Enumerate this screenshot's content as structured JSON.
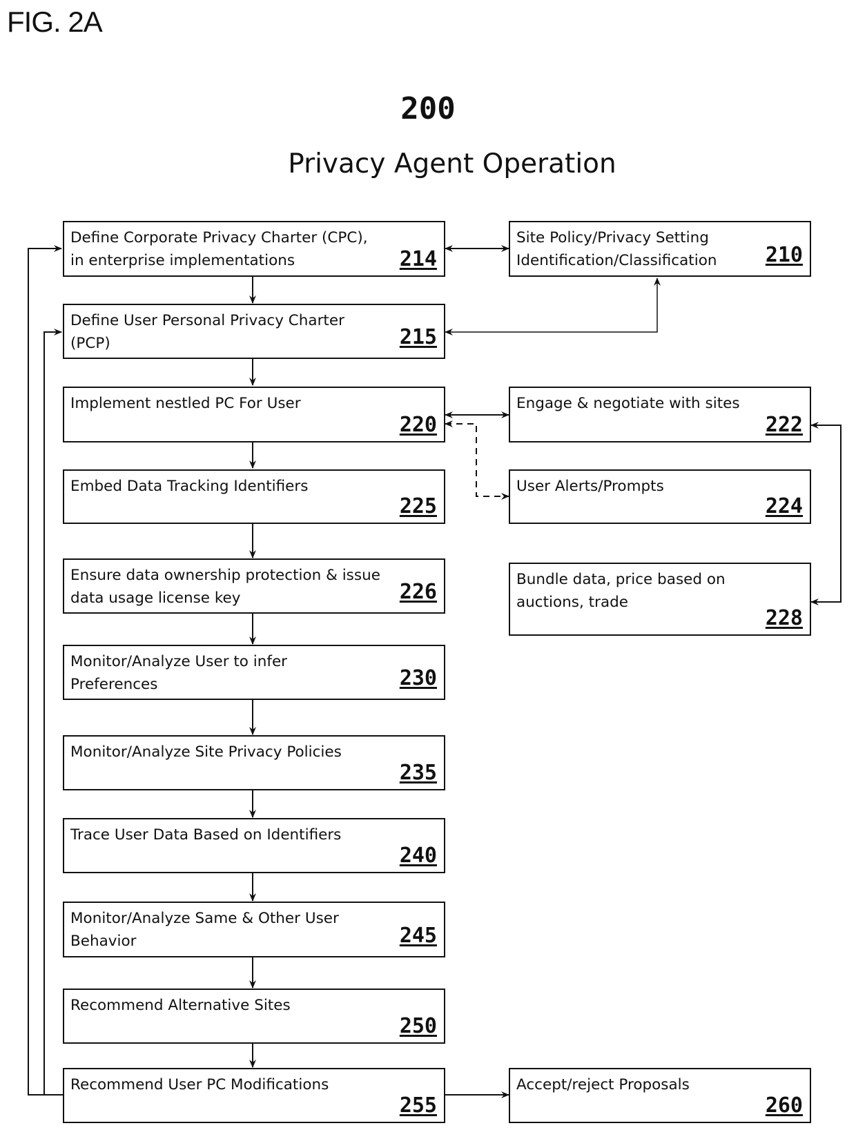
{
  "figure": {
    "label": "FIG. 2A",
    "number": "200",
    "title": "Privacy Agent Operation"
  },
  "boxes": {
    "b214": {
      "text": "Define Corporate Privacy Charter (CPC),\nin enterprise implementations",
      "ref": "214"
    },
    "b210": {
      "text": "Site Policy/Privacy Setting\nIdentification/Classification",
      "ref": "210"
    },
    "b215": {
      "text": "Define User Personal Privacy Charter\n(PCP)",
      "ref": "215"
    },
    "b220": {
      "text": "Implement nestled PC For User",
      "ref": "220"
    },
    "b222": {
      "text": "Engage & negotiate with sites",
      "ref": "222"
    },
    "b225": {
      "text": "Embed Data Tracking Identifiers",
      "ref": "225"
    },
    "b224": {
      "text": "User Alerts/Prompts",
      "ref": "224"
    },
    "b226": {
      "text": "Ensure data ownership protection & issue\ndata usage license key",
      "ref": "226"
    },
    "b228": {
      "text": "Bundle data, price based on\nauctions, trade",
      "ref": "228"
    },
    "b230": {
      "text": "Monitor/Analyze User to infer\nPreferences",
      "ref": "230"
    },
    "b235": {
      "text": "Monitor/Analyze Site Privacy Policies",
      "ref": "235"
    },
    "b240": {
      "text": "Trace User Data Based on Identifiers",
      "ref": "240"
    },
    "b245": {
      "text": "Monitor/Analyze Same & Other User\nBehavior",
      "ref": "245"
    },
    "b250": {
      "text": "Recommend Alternative Sites",
      "ref": "250"
    },
    "b255": {
      "text": "Recommend User PC Modifications",
      "ref": "255"
    },
    "b260": {
      "text": "Accept/reject Proposals",
      "ref": "260"
    }
  },
  "connections": [
    {
      "from": "214",
      "to": "210",
      "style": "solid",
      "direction": "both"
    },
    {
      "from": "214",
      "to": "215",
      "style": "solid",
      "direction": "forward"
    },
    {
      "from": "210",
      "to": "215",
      "style": "solid",
      "direction": "both"
    },
    {
      "from": "215",
      "to": "220",
      "style": "solid",
      "direction": "forward"
    },
    {
      "from": "220",
      "to": "222",
      "style": "solid",
      "direction": "both"
    },
    {
      "from": "220",
      "to": "224",
      "style": "dashed",
      "direction": "both"
    },
    {
      "from": "228",
      "to": "222",
      "style": "solid",
      "direction": "both"
    },
    {
      "from": "220",
      "to": "225",
      "style": "solid",
      "direction": "forward"
    },
    {
      "from": "225",
      "to": "226",
      "style": "solid",
      "direction": "forward"
    },
    {
      "from": "226",
      "to": "230",
      "style": "solid",
      "direction": "forward"
    },
    {
      "from": "230",
      "to": "235",
      "style": "solid",
      "direction": "forward"
    },
    {
      "from": "235",
      "to": "240",
      "style": "solid",
      "direction": "forward"
    },
    {
      "from": "240",
      "to": "245",
      "style": "solid",
      "direction": "forward"
    },
    {
      "from": "245",
      "to": "250",
      "style": "solid",
      "direction": "forward"
    },
    {
      "from": "250",
      "to": "255",
      "style": "solid",
      "direction": "forward"
    },
    {
      "from": "255",
      "to": "260",
      "style": "solid",
      "direction": "forward"
    },
    {
      "from": "255",
      "to": "214",
      "style": "solid",
      "direction": "forward"
    },
    {
      "from": "255",
      "to": "215",
      "style": "solid",
      "direction": "forward"
    }
  ]
}
